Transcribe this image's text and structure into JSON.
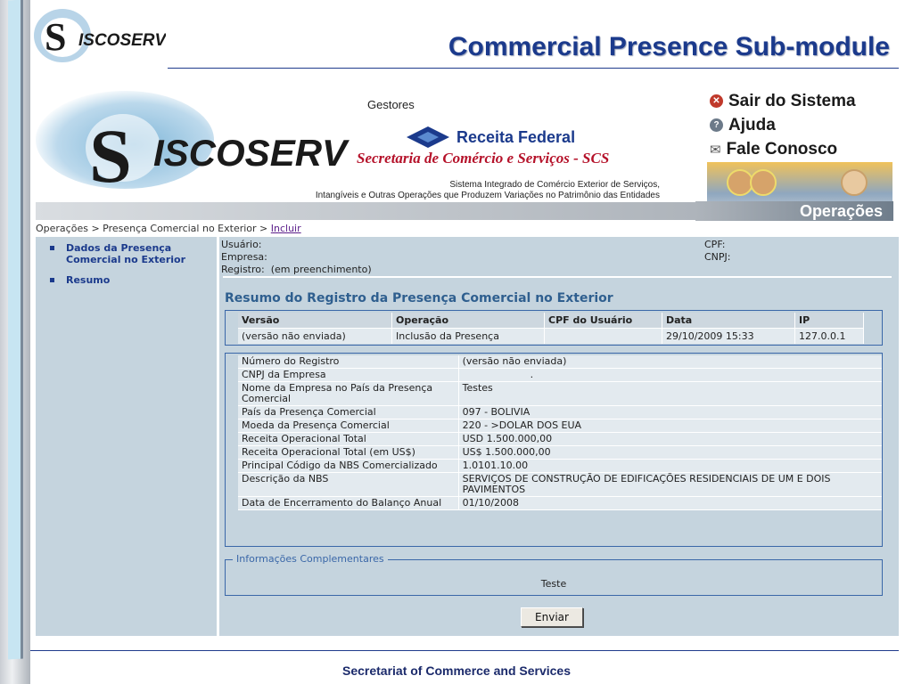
{
  "slide": {
    "title": "Commercial Presence Sub-module",
    "footer": "Secretariat of Commerce and Services",
    "logo_text": "ISCOSERV",
    "logo_letter": "S"
  },
  "app_header": {
    "logo_letter": "S",
    "logo_text": "ISCOSERV",
    "gestores": "Gestores",
    "receita": "Receita Federal",
    "scs": "Secretaria de Comércio e Serviços - SCS",
    "system_line1": "Sistema Integrado de Comércio Exterior de Serviços,",
    "system_line2": "Intangíveis e Outras Operações que Produzem Variações no Patrimônio das Entidades",
    "menu": [
      {
        "label": "Sair do Sistema",
        "icon": "close-icon"
      },
      {
        "label": "Ajuda",
        "icon": "help-icon"
      },
      {
        "label": "Fale Conosco",
        "icon": "mail-icon"
      }
    ],
    "operations_label": "Operações"
  },
  "breadcrumb": {
    "path": "Operações > Presença Comercial no Exterior > ",
    "current": "Incluir"
  },
  "sidebar": {
    "items": [
      {
        "label": "Dados da Presença Comercial no Exterior"
      },
      {
        "label": "Resumo"
      }
    ]
  },
  "user_info": {
    "usuario_label": "Usuário:",
    "empresa_label": "Empresa:",
    "registro_label": "Registro:",
    "registro_value": "(em preenchimento)",
    "cpf_label": "CPF:",
    "cnpj_label": "CNPJ:"
  },
  "summary": {
    "title": "Resumo do Registro da Presença Comercial no Exterior",
    "version_table": {
      "headers": [
        "Versão",
        "Operação",
        "CPF do Usuário",
        "Data",
        "IP"
      ],
      "row": [
        "(versão não enviada)",
        "Inclusão da Presença",
        "",
        "29/10/2009 15:33",
        "127.0.0.1"
      ]
    },
    "details": [
      {
        "label": "Número do Registro",
        "value": "(versão não enviada)"
      },
      {
        "label": "CNPJ da Empresa",
        "value": "."
      },
      {
        "label": "Nome da Empresa no País da Presença Comercial",
        "value": "Testes"
      },
      {
        "label": "País da Presença Comercial",
        "value": "097 - BOLIVIA"
      },
      {
        "label": "Moeda da Presença Comercial",
        "value": "220 - >DOLAR DOS EUA"
      },
      {
        "label": "Receita Operacional Total",
        "value": "USD 1.500.000,00"
      },
      {
        "label": "Receita Operacional Total (em US$)",
        "value": "US$ 1.500.000,00"
      },
      {
        "label": "Principal Código da NBS Comercializado",
        "value": "1.0101.10.00"
      },
      {
        "label": "Descrição da NBS",
        "value": "SERVIÇOS DE CONSTRUÇÃO DE EDIFICAÇÕES RESIDENCIAIS DE UM E DOIS PAVIMENTOS"
      },
      {
        "label": "Data de Encerramento do Balanço Anual",
        "value": "01/10/2008"
      }
    ],
    "complementary": {
      "legend": "Informações Complementares",
      "value": "Teste"
    },
    "submit_label": "Enviar"
  },
  "colors": {
    "title_blue": "#1b3a8c",
    "panel_bg": "#c5d4de",
    "scs_red": "#b5122a"
  }
}
